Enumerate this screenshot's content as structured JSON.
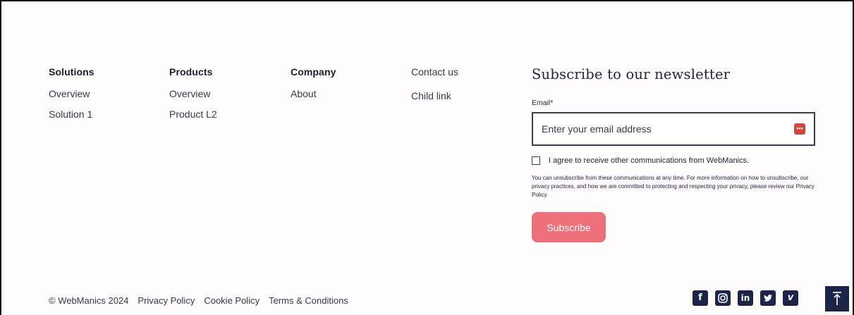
{
  "columns": [
    {
      "heading": "Solutions",
      "links": [
        "Overview",
        "Solution 1"
      ]
    },
    {
      "heading": "Products",
      "links": [
        "Overview",
        "Product L2"
      ]
    },
    {
      "heading": "Company",
      "links": [
        "About"
      ]
    },
    {
      "heading": "",
      "links": [
        "Contact us",
        "Child link"
      ]
    }
  ],
  "newsletter": {
    "title": "Subscribe to our newsletter",
    "email_label": "Email*",
    "email_placeholder": "Enter your email address",
    "email_value": "",
    "consent_label": "I agree to receive other communications from WebManics.",
    "consent_checked": false,
    "fine_print": "You can unsubscribe from these communications at any time. For more information on how to unsubscribe, our privacy practices, and how we are committed to protecting and respecting your privacy, please review our Privacy Policy.",
    "subscribe_label": "Subscribe"
  },
  "footer": {
    "copyright": "© WebManics 2024",
    "links": [
      "Privacy Policy",
      "Cookie Policy",
      "Terms & Conditions"
    ]
  },
  "socials": [
    {
      "icon": "facebook-icon",
      "glyph": "f"
    },
    {
      "icon": "instagram-icon",
      "glyph": "◎"
    },
    {
      "icon": "linkedin-icon",
      "glyph": "in"
    },
    {
      "icon": "twitter-icon",
      "glyph": "🐦"
    },
    {
      "icon": "vimeo-icon",
      "glyph": "v"
    }
  ],
  "colors": {
    "accent_button": "#ec6f79",
    "brand_dark": "#1c2448",
    "background": "#fdfbfb"
  }
}
